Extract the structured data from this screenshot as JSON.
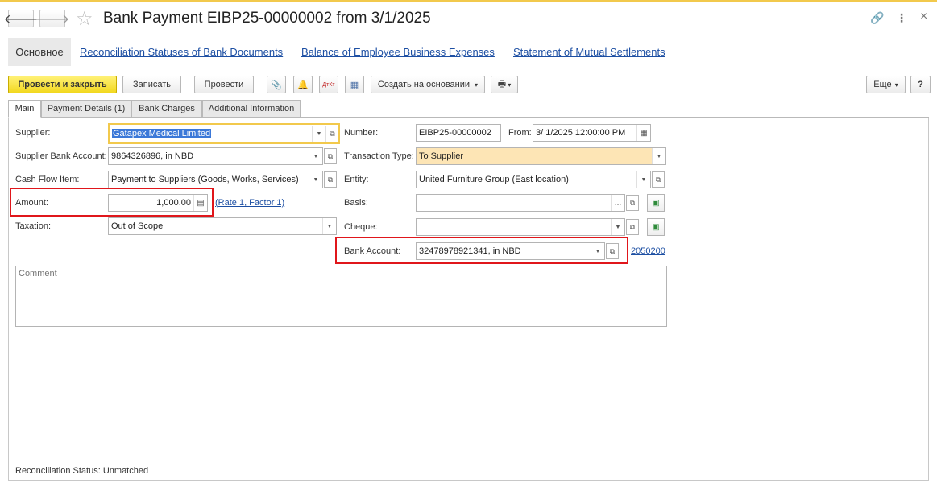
{
  "window": {
    "title": "Bank Payment EIBP25-00000002 from 3/1/2025",
    "nav_back": "🡐",
    "nav_forward": "🡒",
    "favorite_icon": "☆",
    "link_icon": "🔗",
    "menu_icon": "⋮",
    "close_icon": "×"
  },
  "nav_tabs": [
    {
      "label": "Основное"
    },
    {
      "label": "Reconciliation Statuses of Bank Documents"
    },
    {
      "label": "Balance of Employee Business Expenses"
    },
    {
      "label": "Statement of Mutual Settlements"
    }
  ],
  "toolbar": {
    "post_close": "Провести и закрыть",
    "save": "Записать",
    "post": "Провести",
    "create_based_on": "Создать на основании",
    "more": "Еще",
    "help": "?",
    "attach_icon": "📎",
    "bell_icon": "🔔",
    "dtkt_icon": "ДтКт",
    "report_icon": "▦",
    "print_icon": "🖶",
    "dropdown": "▾"
  },
  "tabs": [
    {
      "label": "Main"
    },
    {
      "label": "Payment Details (1)"
    },
    {
      "label": "Bank Charges"
    },
    {
      "label": "Additional Information"
    }
  ],
  "form": {
    "supplier_label": "Supplier:",
    "supplier_value": "Gatapex Medical Limited",
    "supplier_bank_label": "Supplier Bank Account:",
    "supplier_bank_value": "9864326896, in NBD",
    "cash_flow_label": "Cash Flow Item:",
    "cash_flow_value": "Payment to Suppliers (Goods, Works, Services)",
    "amount_label": "Amount:",
    "amount_value": "1,000.00",
    "rate_link": "(Rate 1, Factor 1)",
    "taxation_label": "Taxation:",
    "taxation_value": "Out of Scope",
    "number_label": "Number:",
    "number_value": "EIBP25-00000002",
    "from_label": "From:",
    "from_value": "3/ 1/2025 12:00:00 PM",
    "transaction_type_label": "Transaction Type:",
    "transaction_type_value": "To Supplier",
    "entity_label": "Entity:",
    "entity_value": "United Furniture Group (East location)",
    "basis_label": "Basis:",
    "basis_value": "",
    "cheque_label": "Cheque:",
    "cheque_value": "",
    "bank_account_label": "Bank Account:",
    "bank_account_value": "32478978921341, in NBD",
    "bank_account_code": "2050200",
    "comment_placeholder": "Comment",
    "reconciliation_label": "Reconciliation Status:",
    "reconciliation_value": "Unmatched"
  },
  "colors": {
    "primary_button": "#f2d81f",
    "highlight_box": "#e0161b",
    "transaction_type_bg": "#fde5b5",
    "link": "#1d4fa3"
  }
}
